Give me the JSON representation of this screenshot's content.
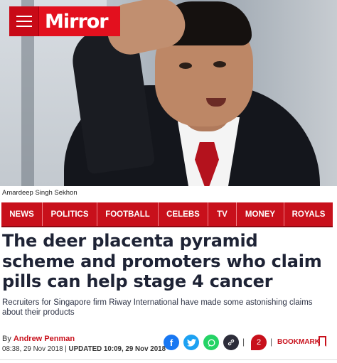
{
  "brand": {
    "logo_text": "Mirror",
    "color": "#e3101e"
  },
  "hero": {
    "caption": "Amardeep Singh Sekhon"
  },
  "nav": {
    "items": [
      {
        "label": "NEWS"
      },
      {
        "label": "POLITICS"
      },
      {
        "label": "FOOTBALL"
      },
      {
        "label": "CELEBS"
      },
      {
        "label": "TV"
      },
      {
        "label": "MONEY"
      },
      {
        "label": "ROYALS"
      }
    ]
  },
  "article": {
    "headline": "The deer placenta pyramid scheme and promoters who claim pills can help stage 4 cancer",
    "standfirst": "Recruiters for Singapore firm Riway International have made some astonishing claims about their products",
    "by_prefix": "By",
    "author": "Andrew Penman",
    "published": "08:38, 29 Nov 2018",
    "updated_label": "UPDATED",
    "updated": "10:09, 29 Nov 2018",
    "comment_count": "2",
    "bookmark_label": "BOOKMARK"
  },
  "share_icons": [
    {
      "name": "facebook-icon",
      "color": "#1877f2",
      "glyph": "f"
    },
    {
      "name": "twitter-icon",
      "color": "#1da1f2",
      "glyph": "t"
    },
    {
      "name": "whatsapp-icon",
      "color": "#25d366",
      "glyph": "w"
    },
    {
      "name": "link-icon",
      "color": "#2d2d3a",
      "glyph": "⛓"
    }
  ]
}
